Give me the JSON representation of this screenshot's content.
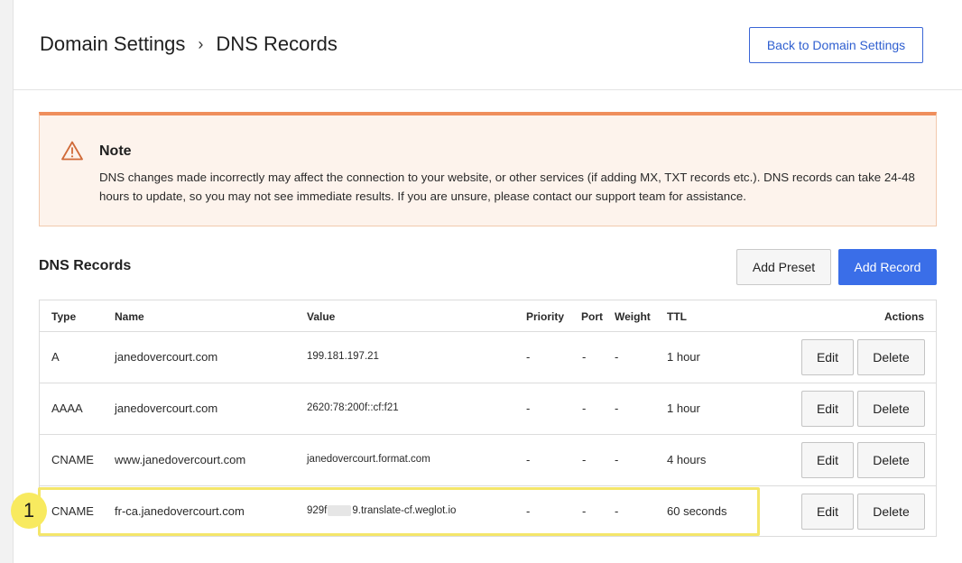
{
  "header": {
    "breadcrumb_parent": "Domain Settings",
    "breadcrumb_separator": "›",
    "breadcrumb_current": "DNS Records",
    "back_button": "Back to Domain Settings"
  },
  "note": {
    "icon": "warning-icon",
    "title": "Note",
    "body": "DNS changes made incorrectly may affect the connection to your website, or other services (if adding MX, TXT records etc.). DNS records can take 24-48 hours to update, so you may not see immediate results. If you are unsure, please contact our support team for assistance."
  },
  "records": {
    "title": "DNS Records",
    "add_preset": "Add Preset",
    "add_record": "Add Record",
    "columns": [
      "Type",
      "Name",
      "Value",
      "Priority",
      "Port",
      "Weight",
      "TTL",
      "Actions"
    ],
    "rows": [
      {
        "type": "A",
        "name": "janedovercourt.com",
        "value": "199.181.197.21",
        "priority": "-",
        "port": "-",
        "weight": "-",
        "ttl": "1 hour",
        "edit": "Edit",
        "delete": "Delete"
      },
      {
        "type": "AAAA",
        "name": "janedovercourt.com",
        "value": "2620:78:200f::cf:f21",
        "priority": "-",
        "port": "-",
        "weight": "-",
        "ttl": "1 hour",
        "edit": "Edit",
        "delete": "Delete"
      },
      {
        "type": "CNAME",
        "name": "www.janedovercourt.com",
        "value": "janedovercourt.format.com",
        "priority": "-",
        "port": "-",
        "weight": "-",
        "ttl": "4 hours",
        "edit": "Edit",
        "delete": "Delete"
      },
      {
        "type": "CNAME",
        "name": "fr-ca.janedovercourt.com",
        "value_prefix": "929f",
        "value_suffix": "9.translate-cf.weglot.io",
        "priority": "-",
        "port": "-",
        "weight": "-",
        "ttl": "60 seconds",
        "edit": "Edit",
        "delete": "Delete"
      }
    ]
  },
  "annotation": {
    "callout_number": "1",
    "highlight_color": "#f4e66a"
  },
  "colors": {
    "accent": "#3a6ee8",
    "note_border": "#ef8e5c",
    "note_bg": "#fdf3ec"
  }
}
